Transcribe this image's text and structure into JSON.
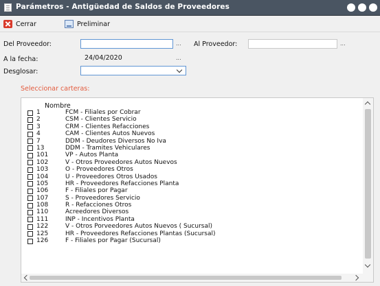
{
  "window": {
    "title": "Parámetros - Antigüedad de Saldos de Proveedores"
  },
  "toolbar": {
    "close_label": "Cerrar",
    "preview_label": "Preliminar"
  },
  "form": {
    "del_proveedor_label": "Del Proveedor:",
    "del_proveedor_value": "",
    "al_proveedor_label": "Al Proveedor:",
    "al_proveedor_value": "",
    "fecha_label": "A la fecha:",
    "fecha_value": "24/04/2020",
    "desglosar_label": "Desglosar:",
    "desglosar_value": "",
    "ellipsis": "..."
  },
  "carteras": {
    "legend": "Seleccionar carteras:",
    "column_header": "Nombre",
    "rows": [
      {
        "code": "1",
        "name": "FCM - Filiales por Cobrar"
      },
      {
        "code": "2",
        "name": "CSM - Clientes Servicio"
      },
      {
        "code": "3",
        "name": "CRM - Clientes Refacciones"
      },
      {
        "code": "4",
        "name": "CAM - Clientes Autos Nuevos"
      },
      {
        "code": "7",
        "name": "DDM - Deudores Diversos No Iva"
      },
      {
        "code": "13",
        "name": "DDM - Tramites Vehiculares"
      },
      {
        "code": "101",
        "name": "VP  -  Autos Planta"
      },
      {
        "code": "102",
        "name": "V  - Otros Proveedores Autos Nuevos"
      },
      {
        "code": "103",
        "name": "O  - Proveedores Otros"
      },
      {
        "code": "104",
        "name": "U  - Proveedores Otros Usados"
      },
      {
        "code": "105",
        "name": "HR  - Proveedores Refacciones Planta"
      },
      {
        "code": "106",
        "name": "F  - Filiales por Pagar"
      },
      {
        "code": "107",
        "name": "S  - Proveedores Servicio"
      },
      {
        "code": "108",
        "name": "R  - Refacciones Otros"
      },
      {
        "code": "110",
        "name": "Acreedores Diversos"
      },
      {
        "code": "111",
        "name": "INP - Incentivos Planta"
      },
      {
        "code": "122",
        "name": "V  -  Otros Porveedores Autos Nuevos ( Sucursal)"
      },
      {
        "code": "125",
        "name": "HR  - Proveedores Refacciones Plantas (Sucursal)"
      },
      {
        "code": "126",
        "name": "F  - Filiales por Pagar (Sucursal)"
      }
    ]
  }
}
